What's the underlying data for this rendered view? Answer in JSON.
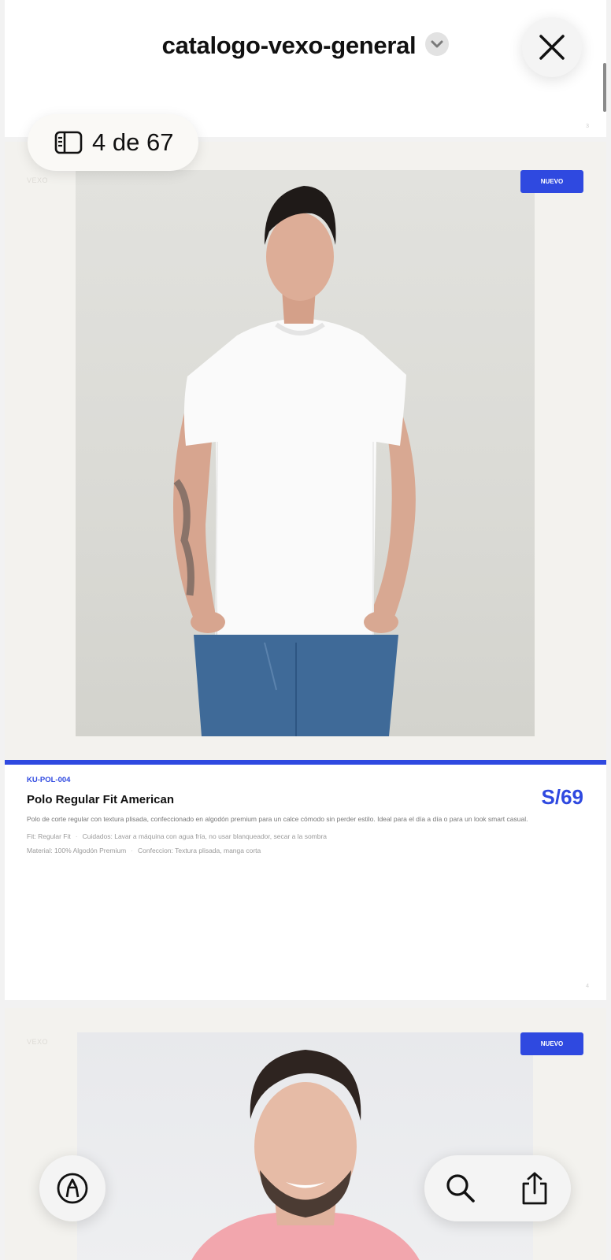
{
  "header": {
    "document_title": "catalogo-vexo-general"
  },
  "page_indicator": {
    "text": "4 de 67"
  },
  "previous_page": {
    "page_number": "3"
  },
  "product": {
    "brand_mark": "VEXO",
    "badge": "NUEVO",
    "sku": "KU-POL-004",
    "name": "Polo Regular Fit American",
    "price": "S/69",
    "description": "Polo de corte regular con textura plisada, confeccionado en algodón premium para un calce cómodo sin perder estilo. Ideal para el día a día o para un look smart casual.",
    "fit": "Fit: Regular Fit",
    "care": "Cuidados: Lavar a máquina con agua fría, no usar blanqueador, secar a la sombra",
    "material": "Material: 100% Algodón Premium",
    "construction": "Confeccion: Textura plisada, manga corta",
    "separator": "·",
    "page_number": "4"
  },
  "next_page": {
    "brand_mark": "VEXO",
    "badge": "NUEVO"
  },
  "colors": {
    "accent": "#2f49e0",
    "page_bg": "#f3f2ee",
    "shirt_next": "#f2a6ad"
  },
  "icons": {
    "close": "xmark-icon",
    "dropdown": "chevron-down-icon",
    "sidebar": "sidebar-icon",
    "markup": "markup-pen-icon",
    "search": "magnifier-icon",
    "share": "share-icon"
  }
}
